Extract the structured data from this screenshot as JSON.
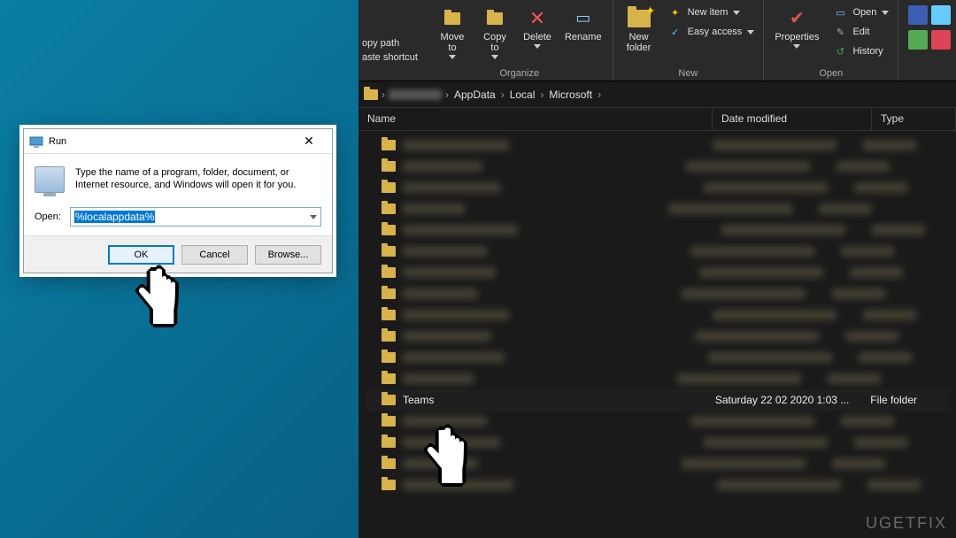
{
  "ribbon": {
    "clipboard": {
      "copy_path": "opy path",
      "paste_shortcut": "aste shortcut"
    },
    "organize": {
      "move_to": "Move\nto",
      "copy_to": "Copy\nto",
      "delete": "Delete",
      "rename": "Rename",
      "label": "Organize"
    },
    "new": {
      "new_folder": "New\nfolder",
      "new_item": "New item",
      "easy_access": "Easy access",
      "label": "New"
    },
    "open": {
      "properties": "Properties",
      "open_btn": "Open",
      "edit": "Edit",
      "history": "History",
      "label": "Open"
    }
  },
  "breadcrumbs": {
    "appdata": "AppData",
    "local": "Local",
    "microsoft": "Microsoft",
    "sep": "›"
  },
  "columns": {
    "name": "Name",
    "date": "Date modified",
    "type": "Type"
  },
  "file": {
    "teams_name": "Teams",
    "teams_date": "Saturday 22 02 2020 1:03 ...",
    "teams_type": "File folder"
  },
  "run": {
    "title": "Run",
    "description": "Type the name of a program, folder, document, or Internet resource, and Windows will open it for you.",
    "open_label": "Open:",
    "input_value": "%localappdata%",
    "ok": "OK",
    "cancel": "Cancel",
    "browse": "Browse..."
  },
  "watermark": "UGETFIX"
}
